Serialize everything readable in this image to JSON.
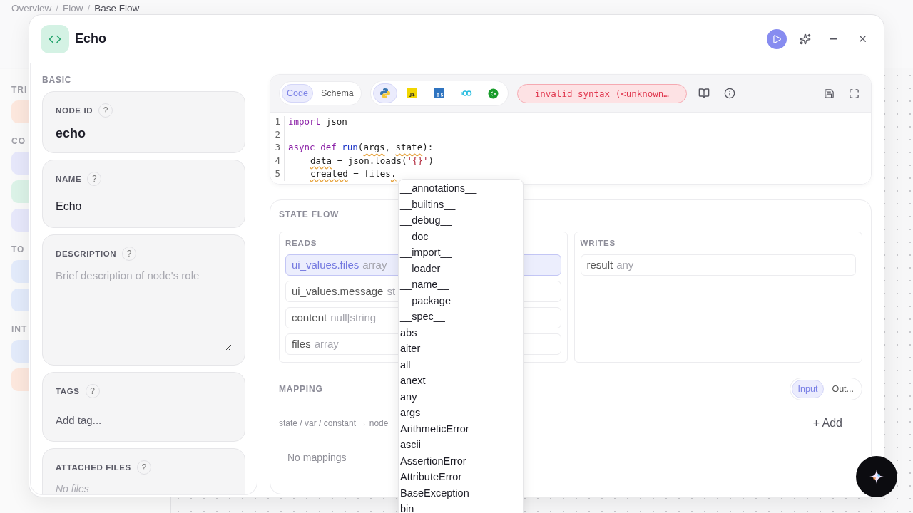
{
  "breadcrumb": [
    {
      "label": "Overview",
      "current": false
    },
    {
      "separator": "/",
      "label": "Flow",
      "current": false
    },
    {
      "separator": "/",
      "label": "Base Flow",
      "current": true
    }
  ],
  "background_sidebar": [
    {
      "label": "TRI",
      "tiles": [
        {
          "color": "#fde8de"
        }
      ]
    },
    {
      "label": "CO",
      "tiles": [
        {
          "color": "#e7e8fb"
        },
        {
          "color": "#dcf3e8"
        },
        {
          "color": "#e7e8fb"
        }
      ]
    },
    {
      "label": "TO",
      "tiles": [
        {
          "color": "#e3ebfb"
        },
        {
          "color": "#e3ebfb"
        }
      ]
    },
    {
      "label": "INT",
      "tiles": [
        {
          "color": "#e3ebfb"
        },
        {
          "color": "#fde8de"
        }
      ]
    }
  ],
  "dialog": {
    "title": "Echo"
  },
  "basic": {
    "heading": "BASIC",
    "fields": [
      {
        "kind": "value",
        "label": "NODE ID",
        "value": "echo",
        "help": "?"
      },
      {
        "kind": "input",
        "label": "NAME",
        "value": "Echo",
        "help": "?"
      },
      {
        "kind": "textarea",
        "label": "DESCRIPTION",
        "placeholder": "Brief description of node's role",
        "help": "?"
      },
      {
        "kind": "tags",
        "label": "TAGS",
        "placeholder": "Add tag...",
        "help": "?"
      },
      {
        "kind": "files",
        "label": "ATTACHED FILES",
        "empty": "No files",
        "help": "?"
      }
    ]
  },
  "editor": {
    "modes": [
      {
        "label": "Code",
        "selected": true
      },
      {
        "label": "Schema",
        "selected": false
      }
    ],
    "languages": [
      {
        "kind": "python",
        "selected": true
      },
      {
        "kind": "js",
        "selected": false
      },
      {
        "kind": "ts",
        "selected": false
      },
      {
        "kind": "go",
        "selected": false
      },
      {
        "kind": "csharp",
        "selected": false
      }
    ],
    "error": "invalid syntax (<unknown…",
    "lines": [
      {
        "number": "1",
        "tokens": [
          {
            "text": "import",
            "kind": "kw"
          },
          {
            "text": " json",
            "kind": "plain"
          }
        ]
      },
      {
        "number": "2"
      },
      {
        "number": "3",
        "tokens": [
          {
            "text": "async def",
            "kind": "kw"
          },
          {
            "text": " run",
            "kind": "fn"
          },
          {
            "text": "(",
            "kind": "plain"
          },
          {
            "text": "args",
            "kind": "plain",
            "squiggle": true
          },
          {
            "text": ", ",
            "kind": "plain"
          },
          {
            "text": "state",
            "kind": "plain",
            "squiggle": true
          },
          {
            "text": "):",
            "kind": "plain"
          }
        ]
      },
      {
        "number": "4",
        "indented": true,
        "tokens": [
          {
            "text": "data",
            "kind": "plain",
            "squiggle": true
          },
          {
            "text": " = json.loads(",
            "kind": "plain"
          },
          {
            "text": "'{}'",
            "kind": "str"
          },
          {
            "text": ")",
            "kind": "plain"
          }
        ]
      },
      {
        "number": "5",
        "indented": true,
        "tokens": [
          {
            "text": "created",
            "kind": "plain",
            "squiggle": true
          },
          {
            "text": " = files",
            "kind": "plain"
          },
          {
            "text": ".",
            "kind": "plain",
            "squiggle": true
          }
        ]
      }
    ],
    "suggestions": [
      "__annotations__",
      "__builtins__",
      "__debug__",
      "__doc__",
      "__import__",
      "__loader__",
      "__name__",
      "__package__",
      "__spec__",
      "abs",
      "aiter",
      "all",
      "anext",
      "any",
      "args",
      "ArithmeticError",
      "ascii",
      "AssertionError",
      "AttributeError",
      "BaseException",
      "bin"
    ]
  },
  "state_flow": {
    "heading": "STATE FLOW",
    "reads": {
      "heading": "READS",
      "items": [
        {
          "name": "ui_values.files",
          "type": "array",
          "selected": true
        },
        {
          "name": "ui_values.message",
          "type": "st",
          "selected": false
        },
        {
          "name": "content",
          "type": "null|string",
          "selected": false
        },
        {
          "name": "files",
          "type": "array",
          "selected": false
        }
      ]
    },
    "writes": {
      "heading": "WRITES",
      "items": [
        {
          "name": "result",
          "type": "any",
          "selected": false
        }
      ]
    },
    "mapping": {
      "heading": "MAPPING",
      "tabs": [
        {
          "label": "Input",
          "selected": true
        },
        {
          "label": "Out...",
          "selected": false
        }
      ],
      "hint": "state / var / constant → node",
      "add": "+ Add",
      "empty": "No mappings"
    }
  }
}
